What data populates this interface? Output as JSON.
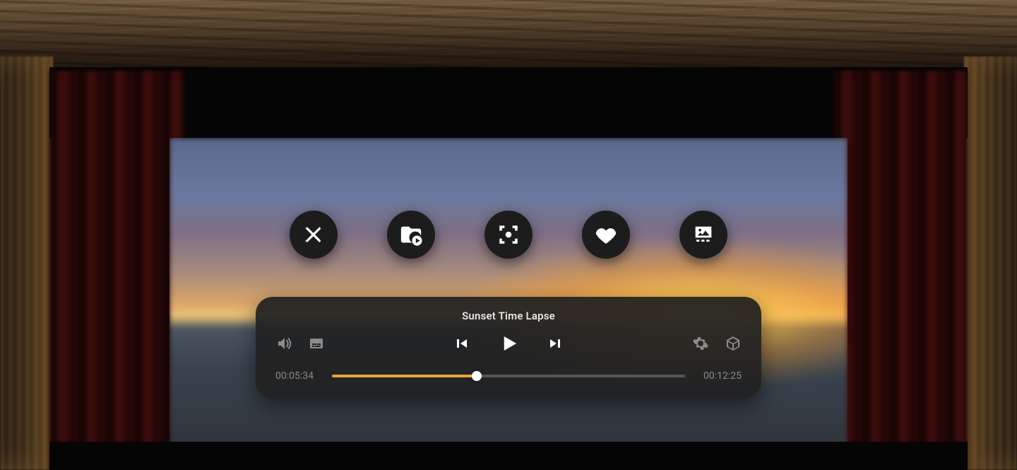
{
  "player": {
    "title": "Sunset Time Lapse",
    "current_time": "00:05:34",
    "total_time": "00:12:25",
    "progress_percent": 41
  },
  "action_icons": {
    "close": "close",
    "folder": "folder-play",
    "focus": "center-focus",
    "favorite": "heart",
    "ambient": "ambient-screen"
  },
  "control_icons": {
    "volume": "volume",
    "subtitles": "subtitles",
    "previous": "skip-previous",
    "play": "play",
    "next": "skip-next",
    "settings": "gear",
    "cube": "cube-3d"
  }
}
